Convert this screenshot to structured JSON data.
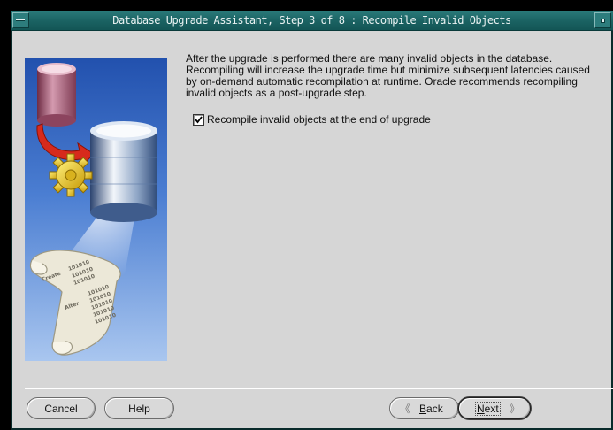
{
  "window": {
    "title": "Database Upgrade Assistant, Step 3 of 8 : Recompile Invalid Objects"
  },
  "content": {
    "description_lines": [
      "After the upgrade is performed there are many invalid objects in the database.",
      "Recompiling will increase the upgrade time but minimize subsequent latencies caused",
      "by on-demand automatic recompilation at runtime. Oracle recommends recompiling",
      "invalid objects as a post-upgrade step."
    ],
    "recompile_checkbox": {
      "label": "Recompile invalid objects at the end of upgrade",
      "checked": true
    }
  },
  "illustration": {
    "scroll_word_1": "Create",
    "scroll_word_2": "Alter",
    "scroll_digits": "101010",
    "icons": [
      "database-icon",
      "arrow-icon",
      "gear-icon",
      "scroll-icon"
    ]
  },
  "buttons": {
    "cancel": "Cancel",
    "help": "Help",
    "back_mnemonic": "B",
    "back_rest": "ack",
    "next_mnemonic": "N",
    "next_rest": "ext",
    "back_glyph": "《",
    "next_glyph": "》"
  },
  "colors": {
    "titlebar": "#1a6262",
    "dialog_bg": "#d6d6d6",
    "illustration_sky": "#2f62c0"
  }
}
